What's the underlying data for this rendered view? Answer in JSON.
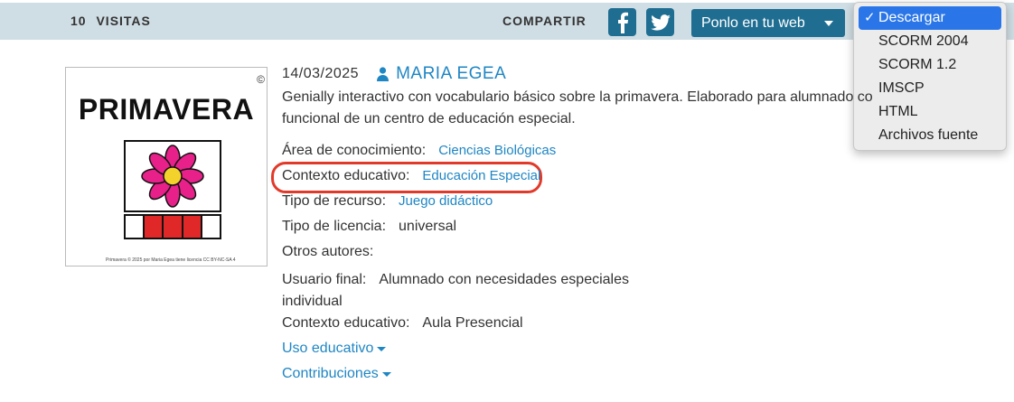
{
  "topbar": {
    "visits_count": "10",
    "visits_label": "VISITAS",
    "share_label": "COMPARTIR",
    "embed_button": "Ponlo en tu web"
  },
  "download_menu": {
    "options": [
      {
        "label": "Descargar",
        "selected": true
      },
      {
        "label": "SCORM 2004"
      },
      {
        "label": "SCORM 1.2"
      },
      {
        "label": "IMSCP"
      },
      {
        "label": "HTML"
      },
      {
        "label": "Archivos fuente"
      }
    ]
  },
  "thumbnail": {
    "title": "PRIMAVERA",
    "credit": "Primavera © 2025 por Maria Egea tiene licencia CC BY-NC-SA 4",
    "colors": {
      "petals": "#e8208a",
      "center": "#f2d22b",
      "cells": "#e02828"
    }
  },
  "resource": {
    "date": "14/03/2025",
    "author": "MARIA EGEA",
    "description_line1": "Genially interactivo con vocabulario básico sobre la primavera. Elaborado para alumnado co",
    "description_line2": "funcional de un centro de educación especial."
  },
  "fields": {
    "area_label": "Área de conocimiento:",
    "area_value": "Ciencias Biológicas",
    "contexto_label": "Contexto educativo:",
    "contexto_value": "Educación Especial",
    "tipo_recurso_label": "Tipo de recurso:",
    "tipo_recurso_value": "Juego didáctico",
    "licencia_label": "Tipo de licencia:",
    "licencia_value": "universal",
    "otros_autores_label": "Otros autores:",
    "usuario_label": "Usuario final:",
    "usuario_value": "Alumnado con necesidades especiales",
    "usuario_value2": "individual",
    "contexto2_label": "Contexto educativo:",
    "contexto2_value": "Aula Presencial",
    "uso_educativo": "Uso educativo",
    "contribuciones": "Contribuciones"
  },
  "accent_colors": {
    "primary": "#1f6e92",
    "link": "#1f86c4",
    "highlight": "#e23a2a",
    "selection": "#2a76e8"
  }
}
